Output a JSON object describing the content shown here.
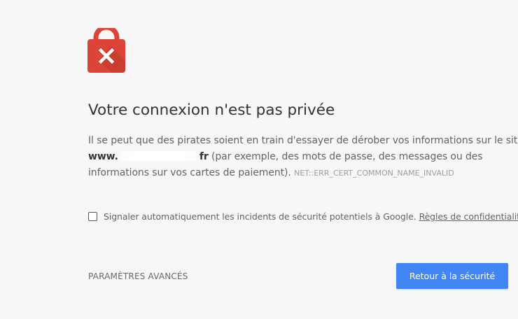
{
  "heading": "Votre connexion n'est pas privée",
  "message": {
    "line1": "Il se peut que des pirates soient en train d'essayer de dérober vos informations sur le site",
    "domain_prefix": "www.",
    "domain_suffix": "fr",
    "line2_rest": " (par exemple, des mots de passe, des messages ou des",
    "line3": "informations sur vos cartes de paiement).",
    "error_code": "NET::ERR_CERT_COMMON_NAME_INVALID"
  },
  "report": {
    "checked": false,
    "label": "Signaler automatiquement les incidents de sécurité potentiels à Google.",
    "privacy_link": "Règles de confidentialité"
  },
  "actions": {
    "advanced_label": "PARAMÈTRES AVANCÉS",
    "back_label": "Retour à la sécurité"
  },
  "colors": {
    "lock": "#db4437",
    "button": "#4285f4",
    "background": "#f7f7f7"
  },
  "icons": {
    "lock": "red-lock-x-icon"
  }
}
